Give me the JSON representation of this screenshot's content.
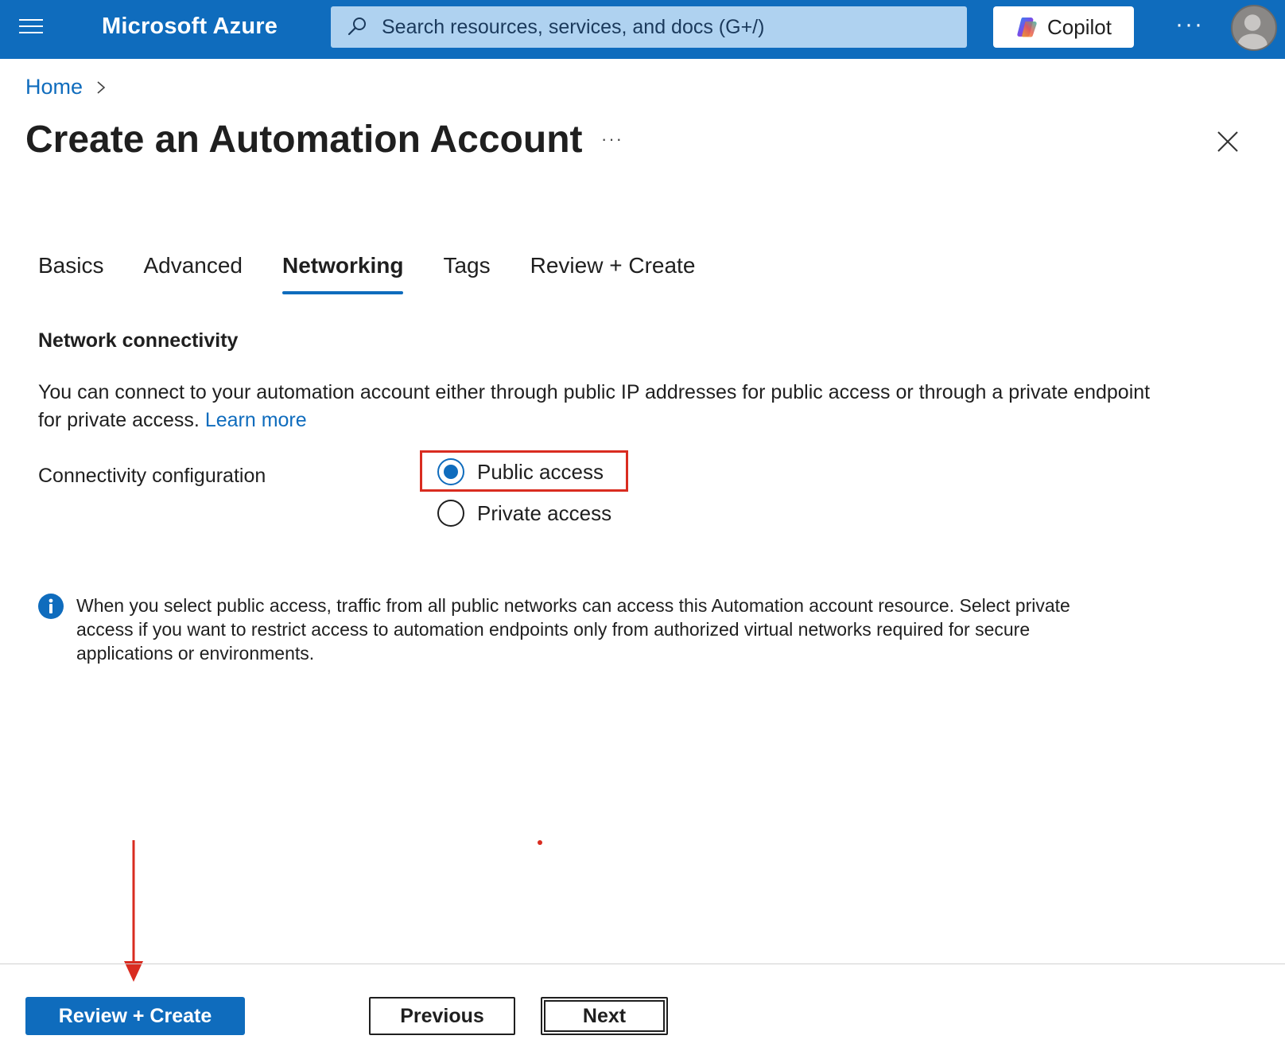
{
  "topbar": {
    "brand": "Microsoft Azure",
    "search_placeholder": "Search resources, services, and docs (G+/)",
    "copilot_label": "Copilot",
    "more": "···"
  },
  "breadcrumb": {
    "home": "Home"
  },
  "page": {
    "title": "Create an Automation Account",
    "more": "···"
  },
  "tabs": [
    {
      "label": "Basics",
      "active": false
    },
    {
      "label": "Advanced",
      "active": false
    },
    {
      "label": "Networking",
      "active": true
    },
    {
      "label": "Tags",
      "active": false
    },
    {
      "label": "Review + Create",
      "active": false
    }
  ],
  "network": {
    "heading": "Network connectivity",
    "description": "You can connect to your automation account either through public IP addresses for public access or through a private endpoint for private access.",
    "learn_more": "Learn more",
    "config_label": "Connectivity configuration",
    "options": [
      {
        "label": "Public access",
        "selected": true
      },
      {
        "label": "Private access",
        "selected": false
      }
    ],
    "info": "When you select public access, traffic from all public networks can access this Automation account resource. Select private access if you want to restrict access to automation endpoints only from authorized virtual networks required for secure applications or environments."
  },
  "footer": {
    "review_create": "Review + Create",
    "previous": "Previous",
    "next": "Next"
  },
  "colors": {
    "accent": "#0f6cbd",
    "annotation": "#d92c20"
  }
}
